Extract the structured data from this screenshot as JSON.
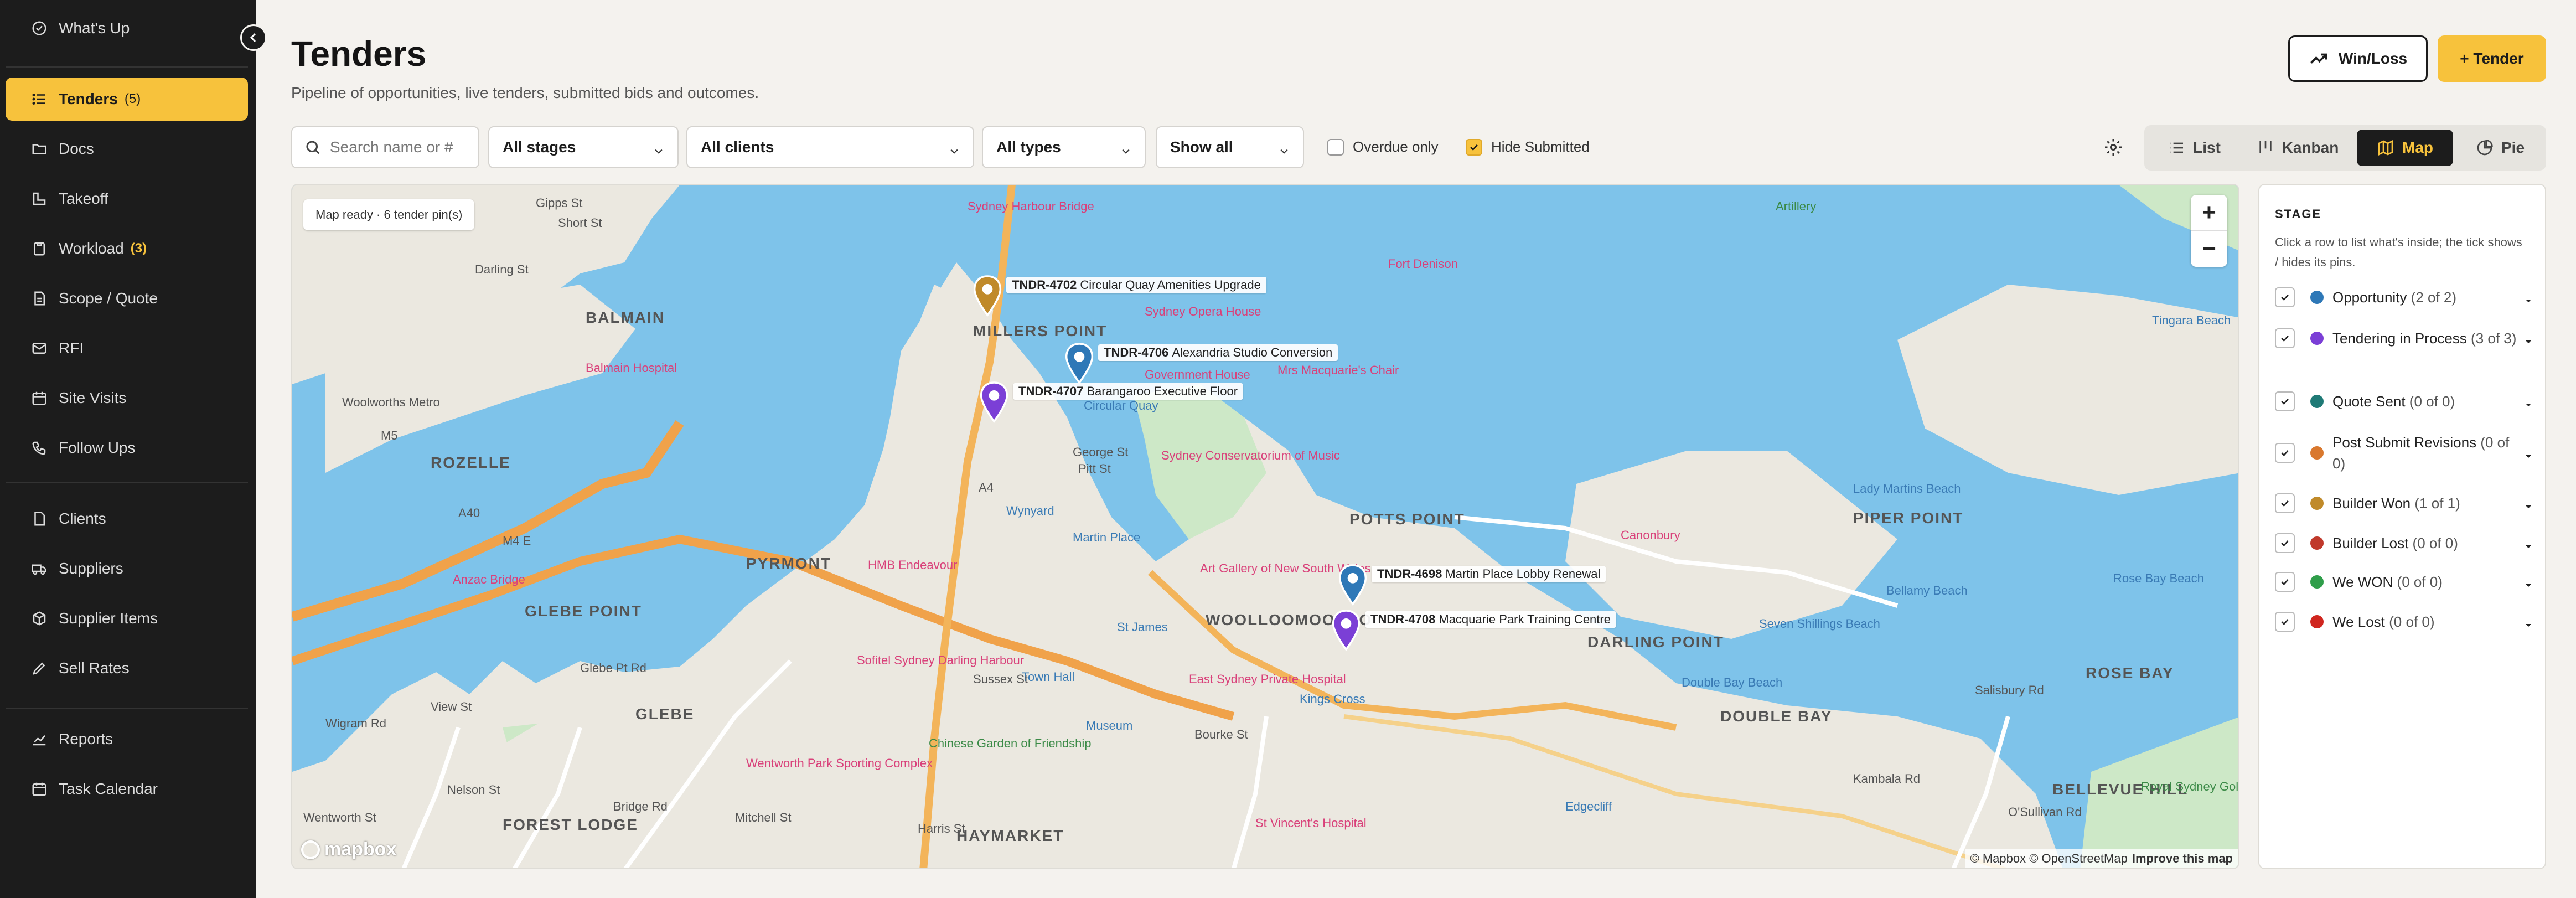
{
  "sidebar": {
    "items": [
      {
        "label": "What's Up",
        "icon": "activity-icon"
      },
      {
        "label": "Tenders",
        "count": "(5)",
        "icon": "list-icon"
      },
      {
        "label": "Docs",
        "icon": "folder-icon"
      },
      {
        "label": "Takeoff",
        "icon": "ruler-icon"
      },
      {
        "label": "Workload",
        "count": "(3)",
        "icon": "clipboard-icon"
      },
      {
        "label": "Scope / Quote",
        "icon": "document-icon"
      },
      {
        "label": "RFI",
        "icon": "mail-icon"
      },
      {
        "label": "Site Visits",
        "icon": "calendar-icon"
      },
      {
        "label": "Follow Ups",
        "icon": "phone-icon"
      },
      {
        "label": "Clients",
        "icon": "document-icon"
      },
      {
        "label": "Suppliers",
        "icon": "truck-icon"
      },
      {
        "label": "Supplier Items",
        "icon": "box-icon"
      },
      {
        "label": "Sell Rates",
        "icon": "pencil-icon"
      },
      {
        "label": "Reports",
        "icon": "chart-icon"
      },
      {
        "label": "Task Calendar",
        "icon": "calendar-icon"
      }
    ]
  },
  "header": {
    "title": "Tenders",
    "subtitle": "Pipeline of opportunities, live tenders, submitted bids and outcomes.",
    "winloss_label": "Win/Loss",
    "add_tender_label": "+ Tender"
  },
  "filters": {
    "search_placeholder": "Search name or #",
    "stages": "All stages",
    "clients": "All clients",
    "types": "All types",
    "show": "Show all",
    "overdue_label": "Overdue only",
    "overdue_checked": false,
    "hide_submitted_label": "Hide Submitted",
    "hide_submitted_checked": true
  },
  "views": {
    "list": "List",
    "kanban": "Kanban",
    "map": "Map",
    "pie": "Pie",
    "active": "map"
  },
  "map": {
    "status": "Map ready · 6 tender pin(s)",
    "zoom_in": "+",
    "zoom_out": "−",
    "pins": [
      {
        "id": "TNDR-4702",
        "name": "Circular Quay Amenities Upgrade",
        "color": "#c08a2a"
      },
      {
        "id": "TNDR-4706",
        "name": "Alexandria Studio Conversion",
        "color": "#2e78b7"
      },
      {
        "id": "TNDR-4707",
        "name": "Barangaroo Executive Floor",
        "color": "#7b3fd6"
      },
      {
        "id": "TNDR-4698",
        "name": "Martin Place Lobby Renewal",
        "color": "#2e78b7"
      },
      {
        "id": "TNDR-4708",
        "name": "Macquarie Park Training Centre",
        "color": "#7b3fd6"
      }
    ],
    "labels": {
      "harbour_bridge": "Sydney Harbour Bridge",
      "opera_house": "Sydney Opera House",
      "fort_denison": "Fort Denison",
      "government_house": "Government House",
      "mrs_macquarie": "Mrs Macquarie's Chair",
      "conservatorium": "Sydney Conservatorium of Music",
      "balmain": "BALMAIN",
      "balmain_hospital": "Balmain Hospital",
      "millers_point": "MILLERS POINT",
      "woolworths": "Woolworths Metro",
      "rozelle": "ROZELLE",
      "pyrmont": "PYRMONT",
      "glebe_point": "GLEBE POINT",
      "glebe": "GLEBE",
      "forest_lodge": "FOREST LODGE",
      "haymarket": "HAYMARKET",
      "potts_point": "POTTS POINT",
      "woolloomooloo": "WOOLLOOMOOLOO",
      "darling_point": "DARLING POINT",
      "double_bay": "DOUBLE BAY",
      "piper_point": "PIPER POINT",
      "rose_bay": "ROSE BAY",
      "bellevue_hill": "BELLEVUE HILL",
      "artillery": "Artillery",
      "tingara": "Tingara Beach",
      "lady_martins": "Lady Martins Beach",
      "canonbury": "Canonbury",
      "bellamy": "Bellamy Beach",
      "seven_shillings": "Seven Shillings Beach",
      "rose_bay_beach": "Rose Bay Beach",
      "double_bay_beach": "Double Bay Beach",
      "art_gallery": "Art Gallery of New South Wales",
      "wynyard": "Wynyard",
      "martin_place": "Martin Place",
      "st_james": "St James",
      "town_hall": "Town Hall",
      "museum": "Museum",
      "kings_cross": "Kings Cross",
      "edgecliff": "Edgecliff",
      "hmb_endeavour": "HMB Endeavour",
      "sofitel": "Sofitel Sydney Darling Harbour",
      "east_sydney": "East Sydney Private Hospital",
      "st_vincents": "St Vincent's Hospital",
      "chinese_garden": "Chinese Garden of Friendship",
      "wentworth_park": "Wentworth Park Sporting Complex",
      "anzac_bridge": "Anzac Bridge",
      "circular_quay": "Circular Quay",
      "royal_sydney_golf": "Royal Sydney Golf Club",
      "darling_st": "Darling St",
      "george_st": "George St",
      "pitt_st": "Pitt St",
      "sussex_st": "Sussex St",
      "bourke_st": "Bourke St",
      "m4e": "M4 E",
      "bridge_rd": "Bridge Rd",
      "glebe_pt_rd": "Glebe Pt Rd",
      "harris_st": "Harris St",
      "mitchell_st": "Mitchell St",
      "nelson_st": "Nelson St",
      "wigram_rd": "Wigram Rd",
      "salisbury_rd": "Salisbury Rd",
      "kambala_rd": "Kambala Rd",
      "osullivan_rd": "O'Sullivan Rd",
      "gipps_st": "Gipps St",
      "short_st": "Short St",
      "view_st": "View St",
      "wentworth_st": "Wentworth St",
      "m5": "M5",
      "a4": "A4",
      "a40": "A40"
    },
    "mapbox_logo": "mapbox",
    "attribution": "© Mapbox © OpenStreetMap",
    "improve": "Improve this map"
  },
  "legend": {
    "heading": "STAGE",
    "hint": "Click a row to list what's inside; the tick shows / hides its pins.",
    "rows": [
      {
        "label": "Opportunity",
        "count": "(2 of 2)",
        "color": "#2e78b7"
      },
      {
        "label": "Tendering in Process",
        "count": "(3 of 3)",
        "color": "#7b3fd6"
      },
      {
        "label": "Quote Sent",
        "count": "(0 of 0)",
        "color": "#1f7a76"
      },
      {
        "label": "Post Submit Revisions",
        "count": "(0 of 0)",
        "color": "#d9782e"
      },
      {
        "label": "Builder Won",
        "count": "(1 of 1)",
        "color": "#c08a2a"
      },
      {
        "label": "Builder Lost",
        "count": "(0 of 0)",
        "color": "#c0392b"
      },
      {
        "label": "We WON",
        "count": "(0 of 0)",
        "color": "#2f9e4a"
      },
      {
        "label": "We Lost",
        "count": "(0 of 0)",
        "color": "#d0261f"
      }
    ]
  }
}
